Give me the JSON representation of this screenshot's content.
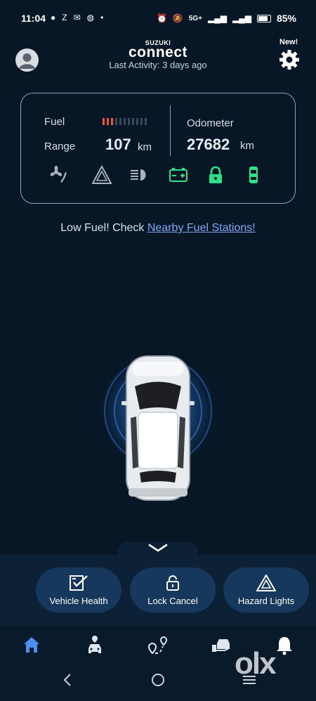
{
  "status_bar": {
    "time": "11:04",
    "network": "5G+",
    "battery": "85%"
  },
  "header": {
    "brand_top": "SUZUKI",
    "brand_name": "connect",
    "last_activity": "Last Activity: 3 days ago",
    "new_badge": "New!"
  },
  "dashboard": {
    "fuel_label": "Fuel",
    "fuel_level_fraction": 0.27,
    "fuel_bar_color": "#e85a3c",
    "range_label": "Range",
    "range_value": "107",
    "range_unit": "km",
    "odometer_label": "Odometer",
    "odometer_value": "27682",
    "odometer_unit": "km",
    "indicators": [
      {
        "icon": "ac-fan-icon",
        "status": "off"
      },
      {
        "icon": "hazard-icon",
        "status": "off"
      },
      {
        "icon": "headlight-icon",
        "status": "off"
      },
      {
        "icon": "battery-icon",
        "status": "ok"
      },
      {
        "icon": "lock-icon",
        "status": "ok"
      },
      {
        "icon": "door-icon",
        "status": "ok"
      }
    ],
    "ok_color": "#2fe08a"
  },
  "alert": {
    "text": "Low Fuel! Check ",
    "link_text": "Nearby Fuel Stations!"
  },
  "actions": [
    {
      "label": "Vehicle Health",
      "icon": "vehicle-health-icon"
    },
    {
      "label": "Lock Cancel",
      "icon": "lock-open-icon"
    },
    {
      "label": "Hazard Lights",
      "icon": "hazard-icon"
    }
  ],
  "bottom_nav": [
    {
      "icon": "home-icon",
      "active": true
    },
    {
      "icon": "car-location-icon",
      "active": false
    },
    {
      "icon": "route-icon",
      "active": false
    },
    {
      "icon": "service-icon",
      "active": false
    },
    {
      "icon": "bell-icon",
      "active": false
    }
  ],
  "watermark": "olx",
  "colors": {
    "background": "#081726",
    "accent": "#4d8ff0",
    "button": "#16385c"
  }
}
